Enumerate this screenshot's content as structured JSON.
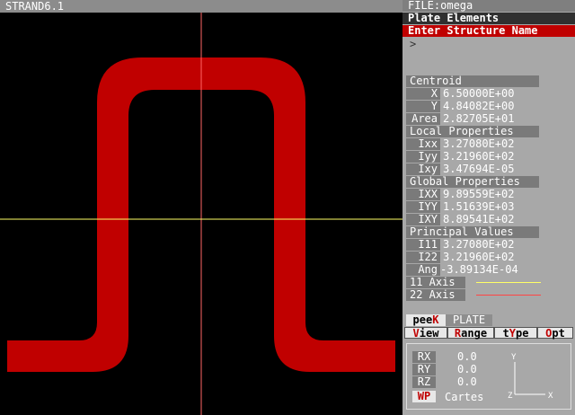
{
  "window": {
    "title": "STRAND6.1"
  },
  "panel": {
    "file": "FILE:omega",
    "mode": "Plate Elements",
    "prompt": "Enter Structure Name",
    "input_caret": ">",
    "centroid": {
      "header": "Centroid",
      "rows": [
        {
          "label": "X",
          "value": "6.50000E+00"
        },
        {
          "label": "Y",
          "value": "4.84082E+00"
        },
        {
          "label": "Area",
          "value": "2.82705E+01"
        }
      ]
    },
    "local": {
      "header": "Local Properties",
      "rows": [
        {
          "label": "Ixx",
          "value": "3.27080E+02"
        },
        {
          "label": "Iyy",
          "value": "3.21960E+02"
        },
        {
          "label": "Ixy",
          "value": "3.47694E-05"
        }
      ]
    },
    "global": {
      "header": "Global Properties",
      "rows": [
        {
          "label": "IXX",
          "value": "9.89559E+02"
        },
        {
          "label": "IYY",
          "value": "1.51639E+03"
        },
        {
          "label": "IXY",
          "value": "8.89541E+02"
        }
      ]
    },
    "principal": {
      "header": "Principal Values",
      "rows": [
        {
          "label": "I11",
          "value": "3.27080E+02"
        },
        {
          "label": "I22",
          "value": "3.21960E+02"
        },
        {
          "label": "Ang",
          "value": "-3.89134E-04"
        }
      ]
    },
    "axes": [
      {
        "label": "11 Axis",
        "color": "#ffff66"
      },
      {
        "label": "22 Axis",
        "color": "#ff4444"
      }
    ],
    "tabs": {
      "peek_prefix": "pee",
      "peek_hot": "K",
      "plate": "PLATE"
    },
    "menu": {
      "view_hot": "V",
      "view_rest": "iew",
      "range_hot": "R",
      "range_rest": "ange",
      "type_a": "t",
      "type_hot": "Y",
      "type_b": "pe",
      "opt_hot": "O",
      "opt_rest": "pt"
    },
    "workplane": {
      "rows": [
        {
          "label": "RX",
          "value": "0.0"
        },
        {
          "label": "RY",
          "value": "0.0"
        },
        {
          "label": "RZ",
          "value": "0.0"
        }
      ],
      "button": "WP",
      "mode": "Cartes",
      "triad": {
        "y": "Y",
        "z": "Z",
        "x": "X"
      }
    }
  },
  "colors": {
    "section": "#c00000",
    "crosshair_v": "#ff6666",
    "crosshair_h": "#ffff66"
  }
}
